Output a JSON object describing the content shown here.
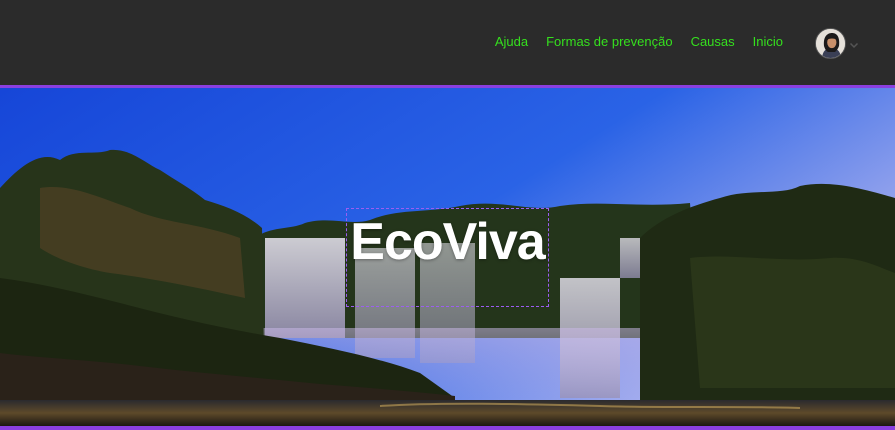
{
  "nav": {
    "links": [
      "Ajuda",
      "Formas de prevenção",
      "Causas",
      "Inicio"
    ],
    "link_color": "#35e01e",
    "avatar_icon": "user-avatar",
    "dropdown_icon": "chevron-down-icon"
  },
  "hero": {
    "title": "EcoViva",
    "image": "waterfall-landscape"
  },
  "colors": {
    "background": "#2b2b2b",
    "accent": "#8b3fe0",
    "link": "#35e01e"
  }
}
